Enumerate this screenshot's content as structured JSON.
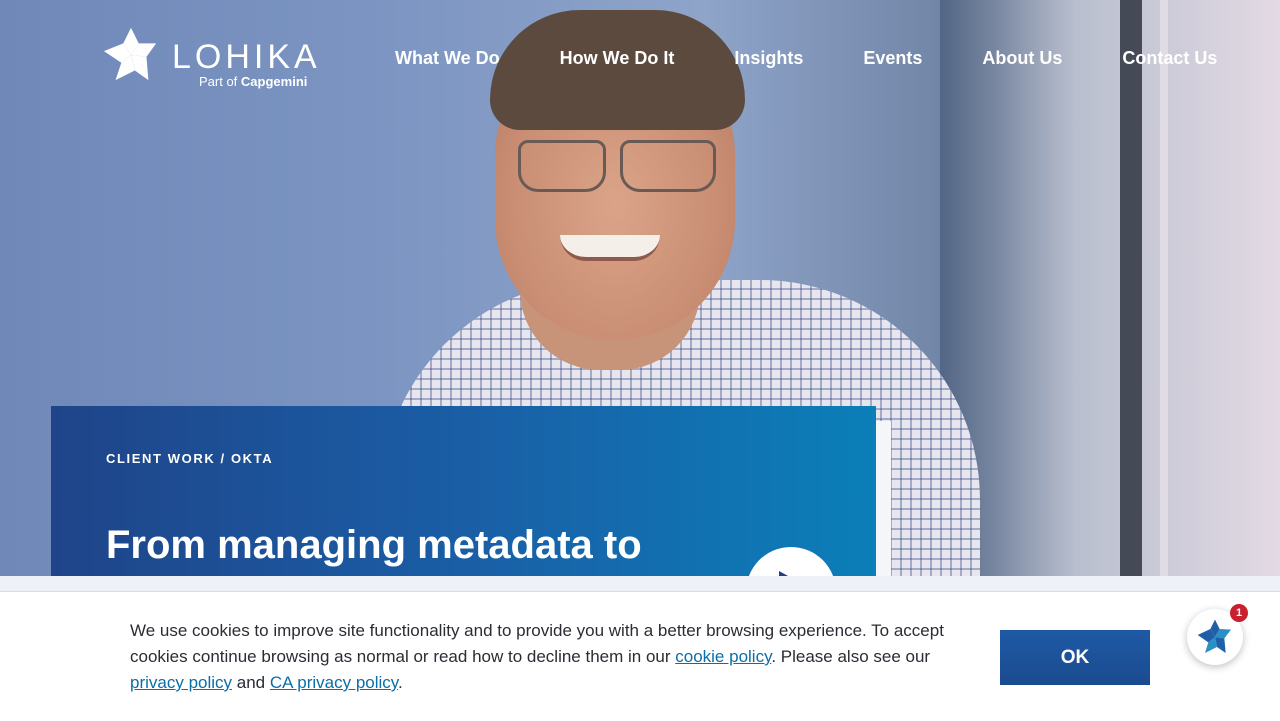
{
  "brand": {
    "name": "LOHIKA",
    "tagline_prefix": "Part of",
    "tagline_company": "Capgemini"
  },
  "nav": {
    "items": [
      "What We Do",
      "How We Do It",
      "Insights",
      "Events",
      "About Us",
      "Contact Us"
    ]
  },
  "hero": {
    "eyebrow": "CLIENT WORK / OKTA",
    "title": "From managing metadata to building mobile SDKs, see how"
  },
  "cookie": {
    "text_1": "We use cookies to improve site functionality and to provide you with a better browsing experience. To accept cookies continue browsing as normal or read how to decline them in our ",
    "cookie_policy_link": "cookie policy",
    "text_2": ". Please also see our ",
    "privacy_link": "privacy policy",
    "text_3": " and ",
    "ca_privacy_link": "CA privacy policy",
    "text_4": ".",
    "ok_label": "OK"
  },
  "chat": {
    "icon": "lohika-star-icon",
    "badge_count": "1"
  },
  "colors": {
    "card_start": "#1f4489",
    "card_end": "#0b7fb8",
    "link": "#0a6fa8",
    "badge": "#c8202e"
  }
}
